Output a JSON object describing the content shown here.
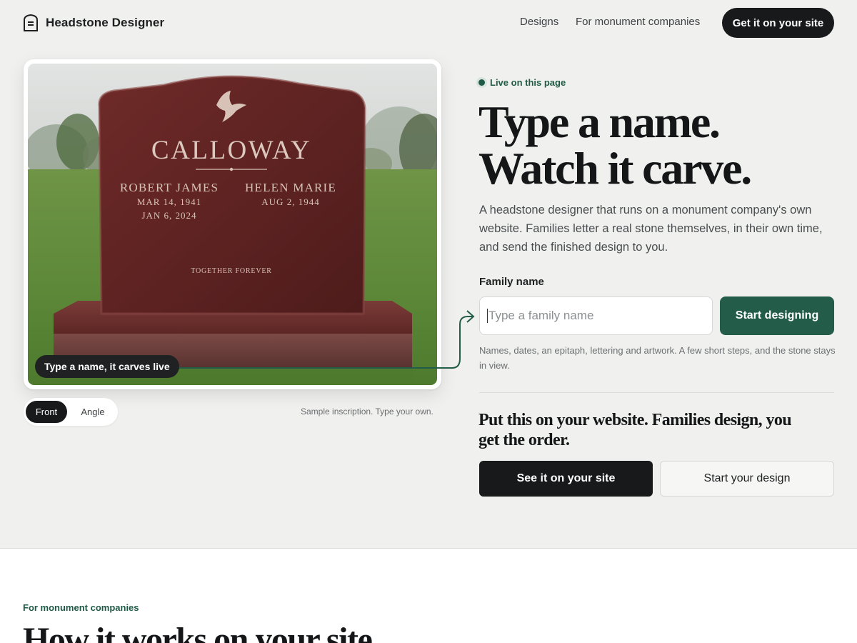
{
  "header": {
    "brand_name": "Headstone Designer",
    "nav": [
      {
        "label": "Designs"
      },
      {
        "label": "For monument companies"
      }
    ],
    "cta_label": "Get it on your site"
  },
  "stone": {
    "family": "CALLOWAY",
    "person1_name": "ROBERT JAMES",
    "person1_born": "MAR 14, 1941",
    "person1_died": "JAN 6, 2024",
    "person2_name": "HELEN MARIE",
    "person2_born": "AUG 2, 1944",
    "epitaph": "TOGETHER FOREVER",
    "artwork_icon": "dove-icon",
    "live_pill": "Type a name, it carves live"
  },
  "view_toggle": {
    "front_label": "Front",
    "angle_label": "Angle",
    "selected": "Front"
  },
  "sample_note": "Sample inscription. Type your own.",
  "hero": {
    "live_badge": "Live on this page",
    "headline_line1": "Type a name.",
    "headline_line2": "Watch it carve.",
    "intro": "A headstone designer that runs on a monument company's own website. Families letter a real stone themselves, in their own time, and send the finished design to you.",
    "field_label": "Family name",
    "input_placeholder": "Type a family name",
    "input_value": "",
    "start_button": "Start designing",
    "help_text": "Names, dates, an epitaph, lettering and artwork. A few short steps, and the stone stays in view.",
    "subhead": "Put this on your website. Families design, you get the order.",
    "btn_primary": "See it on your site",
    "btn_secondary": "Start your design"
  },
  "section": {
    "eyebrow": "For monument companies",
    "title": "How it works on your site"
  },
  "colors": {
    "accent_green": "#235c49",
    "dark": "#17191a",
    "page_bg": "#f0f0ef",
    "stone_red": "#6b2626"
  }
}
